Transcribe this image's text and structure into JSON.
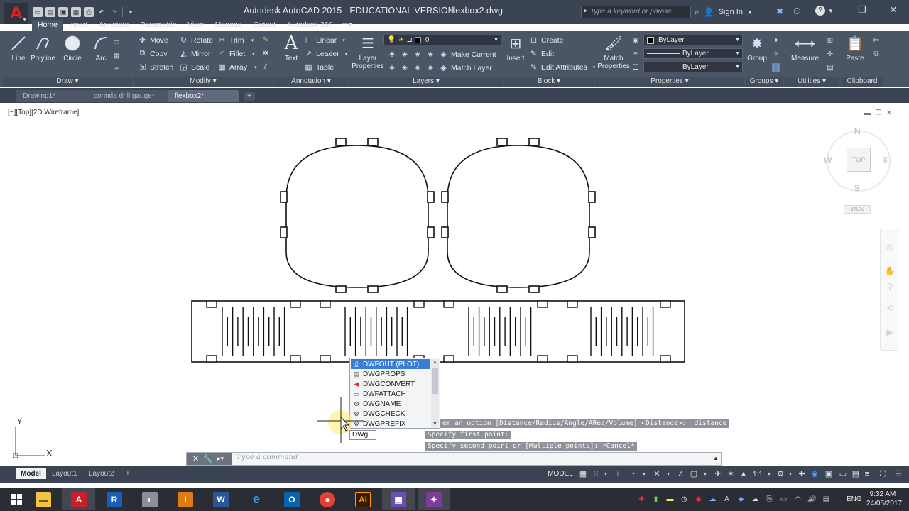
{
  "window": {
    "app_title": "Autodesk AutoCAD 2015 - EDUCATIONAL VERSION",
    "doc_title": "flexbox2.dwg",
    "search_placeholder": "Type a keyword or phrase",
    "sign_in": "Sign In"
  },
  "ribbon_tabs": [
    "Home",
    "Insert",
    "Annotate",
    "Parametric",
    "View",
    "Manage",
    "Output",
    "Autodesk 360"
  ],
  "ribbon": {
    "draw": {
      "title": "Draw",
      "line": "Line",
      "polyline": "Polyline",
      "circle": "Circle",
      "arc": "Arc"
    },
    "modify": {
      "title": "Modify",
      "move": "Move",
      "rotate": "Rotate",
      "trim": "Trim",
      "copy": "Copy",
      "mirror": "Mirror",
      "fillet": "Fillet",
      "stretch": "Stretch",
      "scale": "Scale",
      "array": "Array"
    },
    "annotation": {
      "title": "Annotation",
      "text": "Text",
      "linear": "Linear",
      "leader": "Leader",
      "table": "Table"
    },
    "layers": {
      "title": "Layers",
      "layer_properties": "Layer Properties",
      "current_layer": "0",
      "make_current": "Make Current",
      "match_layer": "Match Layer"
    },
    "block": {
      "title": "Block",
      "insert": "Insert",
      "create": "Create",
      "edit": "Edit",
      "edit_attributes": "Edit Attributes"
    },
    "properties": {
      "title": "Properties",
      "match_properties": "Match Properties",
      "color": "ByLayer",
      "linetype": "ByLayer",
      "lineweight": "ByLayer"
    },
    "groups": {
      "title": "Groups",
      "group": "Group"
    },
    "utilities": {
      "title": "Utilities",
      "measure": "Measure"
    },
    "clipboard": {
      "title": "Clipboard",
      "paste": "Paste"
    }
  },
  "file_tabs": [
    "Drawing1*",
    "corinda drill gauge*",
    "flexbox2*"
  ],
  "viewport": {
    "label": "[−][Top][2D Wireframe]",
    "viewcube": {
      "n": "N",
      "s": "S",
      "e": "E",
      "w": "W",
      "top": "TOP",
      "wcs": "WCS"
    }
  },
  "autocomplete": {
    "items": [
      "DWFOUT (PLOT)",
      "DWGPROPS",
      "DWGCONVERT",
      "DWFATTACH",
      "DWGNAME",
      "DWGCHECK",
      "DWGPREFIX"
    ],
    "typed": "DWg"
  },
  "command_history": [
    "er an option [Distance/Radius/Angle/ARea/Volume] <Distance>: _distance",
    "Specify first point:",
    "Specify second point or [Multiple points]: *Cancel*"
  ],
  "command_line": {
    "placeholder": "Type a command"
  },
  "ucs": {
    "x": "X",
    "y": "Y"
  },
  "layout_tabs": [
    "Model",
    "Layout1",
    "Layout2"
  ],
  "status": {
    "model": "MODEL",
    "scale": "1:1"
  },
  "taskbar": {
    "language": "ENG",
    "time": "9:32 AM",
    "date": "24/05/2017"
  },
  "colors": {
    "titlebar": "#3b4452",
    "ribbon": "#4a5566",
    "selection": "#3a7bd5",
    "app_logo": "#e02020"
  }
}
